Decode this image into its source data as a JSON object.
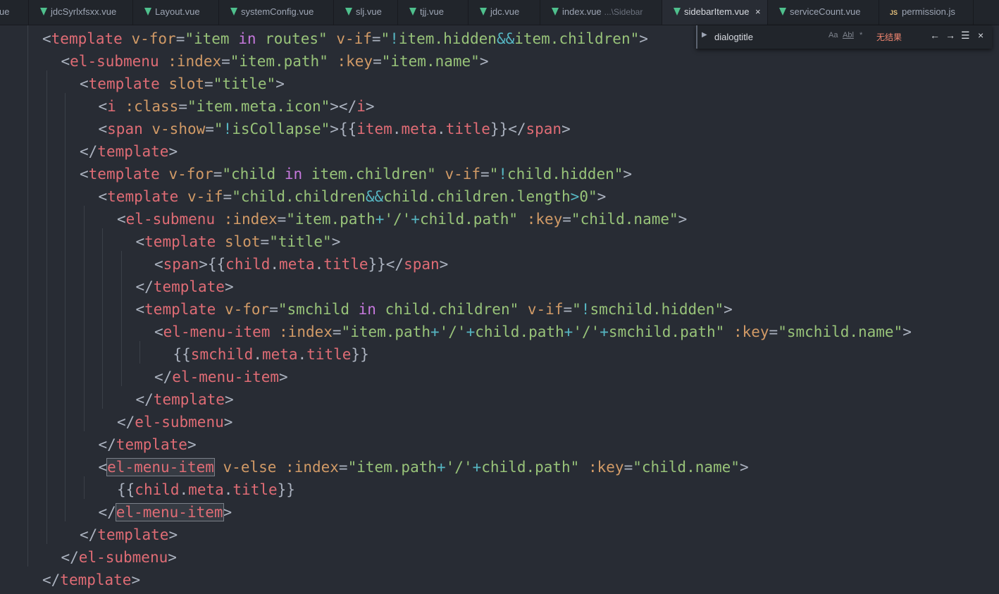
{
  "colors": {
    "editor_bg": "#282c34",
    "tag": "#e06c75",
    "attribute": "#d19a66",
    "string": "#98c379",
    "keyword": "#c678dd",
    "operator": "#56b6c2",
    "text": "#abb2bf",
    "vue_icon": "#4fc08d"
  },
  "tabs": [
    {
      "label": "ue",
      "icon": "",
      "hint": ""
    },
    {
      "label": "jdcSyrlxfsxx.vue",
      "icon": "vue-icon",
      "hint": ""
    },
    {
      "label": "Layout.vue",
      "icon": "vue-icon",
      "hint": ""
    },
    {
      "label": "systemConfig.vue",
      "icon": "vue-icon",
      "hint": ""
    },
    {
      "label": "slj.vue",
      "icon": "vue-icon",
      "hint": ""
    },
    {
      "label": "tjj.vue",
      "icon": "vue-icon",
      "hint": ""
    },
    {
      "label": "jdc.vue",
      "icon": "vue-icon",
      "hint": ""
    },
    {
      "label": "index.vue",
      "icon": "vue-icon",
      "hint": "...\\Sidebar"
    },
    {
      "label": "sidebarItem.vue",
      "icon": "vue-icon",
      "hint": ""
    },
    {
      "label": "serviceCount.vue",
      "icon": "vue-icon",
      "hint": ""
    },
    {
      "label": "permission.js",
      "icon": "js-icon",
      "hint": ""
    }
  ],
  "active_tab_close": "×",
  "js_icon_text": "JS",
  "find": {
    "value": "dialogtitle",
    "match_case": "Aa",
    "whole_word": "Abl",
    "regex": "*",
    "result": "无结果",
    "prev": "←",
    "next": "→",
    "in_selection": "☰",
    "close": "×"
  },
  "code_lines": [
    [
      [
        "t",
        "<"
      ],
      [
        "tag",
        "template"
      ],
      [
        "t",
        " "
      ],
      [
        "attr",
        "v-for"
      ],
      [
        "t",
        "="
      ],
      [
        "str",
        "\"item "
      ],
      [
        "kw",
        "in"
      ],
      [
        "str",
        " routes\""
      ],
      [
        "t",
        " "
      ],
      [
        "attr",
        "v-if"
      ],
      [
        "t",
        "="
      ],
      [
        "str",
        "\""
      ],
      [
        "op",
        "!"
      ],
      [
        "str",
        "item.hidden"
      ],
      [
        "op",
        "&&"
      ],
      [
        "str",
        "item.children\""
      ],
      [
        "t",
        ">"
      ]
    ],
    [
      [
        "t",
        "<"
      ],
      [
        "tag",
        "el-submenu"
      ],
      [
        "t",
        " "
      ],
      [
        "attr",
        ":index"
      ],
      [
        "t",
        "="
      ],
      [
        "str",
        "\"item.path\""
      ],
      [
        "t",
        " "
      ],
      [
        "attr",
        ":key"
      ],
      [
        "t",
        "="
      ],
      [
        "str",
        "\"item.name\""
      ],
      [
        "t",
        ">"
      ]
    ],
    [
      [
        "t",
        "<"
      ],
      [
        "tag",
        "template"
      ],
      [
        "t",
        " "
      ],
      [
        "attr",
        "slot"
      ],
      [
        "t",
        "="
      ],
      [
        "str",
        "\"title\""
      ],
      [
        "t",
        ">"
      ]
    ],
    [
      [
        "t",
        "<"
      ],
      [
        "tag",
        "i"
      ],
      [
        "t",
        " "
      ],
      [
        "attr",
        ":class"
      ],
      [
        "t",
        "="
      ],
      [
        "str",
        "\"item.meta.icon\""
      ],
      [
        "t",
        "></"
      ],
      [
        "tag",
        "i"
      ],
      [
        "t",
        ">"
      ]
    ],
    [
      [
        "t",
        "<"
      ],
      [
        "tag",
        "span"
      ],
      [
        "t",
        " "
      ],
      [
        "attr",
        "v-show"
      ],
      [
        "t",
        "="
      ],
      [
        "str",
        "\""
      ],
      [
        "op",
        "!"
      ],
      [
        "str",
        "isCollapse\""
      ],
      [
        "t",
        ">{{"
      ],
      [
        "tag",
        "item"
      ],
      [
        "t",
        "."
      ],
      [
        "tag",
        "meta"
      ],
      [
        "t",
        "."
      ],
      [
        "tag",
        "title"
      ],
      [
        "t",
        "}}</"
      ],
      [
        "tag",
        "span"
      ],
      [
        "t",
        ">"
      ]
    ],
    [
      [
        "t",
        "</"
      ],
      [
        "tag",
        "template"
      ],
      [
        "t",
        ">"
      ]
    ],
    [
      [
        "t",
        "<"
      ],
      [
        "tag",
        "template"
      ],
      [
        "t",
        " "
      ],
      [
        "attr",
        "v-for"
      ],
      [
        "t",
        "="
      ],
      [
        "str",
        "\"child "
      ],
      [
        "kw",
        "in"
      ],
      [
        "str",
        " item.children\""
      ],
      [
        "t",
        " "
      ],
      [
        "attr",
        "v-if"
      ],
      [
        "t",
        "="
      ],
      [
        "str",
        "\""
      ],
      [
        "op",
        "!"
      ],
      [
        "str",
        "child.hidden\""
      ],
      [
        "t",
        ">"
      ]
    ],
    [
      [
        "t",
        "<"
      ],
      [
        "tag",
        "template"
      ],
      [
        "t",
        " "
      ],
      [
        "attr",
        "v-if"
      ],
      [
        "t",
        "="
      ],
      [
        "str",
        "\"child.children"
      ],
      [
        "op",
        "&&"
      ],
      [
        "str",
        "child.children.length"
      ],
      [
        "op",
        ">"
      ],
      [
        "str",
        "0\""
      ],
      [
        "t",
        ">"
      ]
    ],
    [
      [
        "t",
        "<"
      ],
      [
        "tag",
        "el-submenu"
      ],
      [
        "t",
        " "
      ],
      [
        "attr",
        ":index"
      ],
      [
        "t",
        "="
      ],
      [
        "str",
        "\"item.path"
      ],
      [
        "op",
        "+"
      ],
      [
        "str",
        "'/'"
      ],
      [
        "op",
        "+"
      ],
      [
        "str",
        "child.path\""
      ],
      [
        "t",
        " "
      ],
      [
        "attr",
        ":key"
      ],
      [
        "t",
        "="
      ],
      [
        "str",
        "\"child.name\""
      ],
      [
        "t",
        ">"
      ]
    ],
    [
      [
        "t",
        "<"
      ],
      [
        "tag",
        "template"
      ],
      [
        "t",
        " "
      ],
      [
        "attr",
        "slot"
      ],
      [
        "t",
        "="
      ],
      [
        "str",
        "\"title\""
      ],
      [
        "t",
        ">"
      ]
    ],
    [
      [
        "t",
        "<"
      ],
      [
        "tag",
        "span"
      ],
      [
        "t",
        ">{{"
      ],
      [
        "tag",
        "child"
      ],
      [
        "t",
        "."
      ],
      [
        "tag",
        "meta"
      ],
      [
        "t",
        "."
      ],
      [
        "tag",
        "title"
      ],
      [
        "t",
        "}}</"
      ],
      [
        "tag",
        "span"
      ],
      [
        "t",
        ">"
      ]
    ],
    [
      [
        "t",
        "</"
      ],
      [
        "tag",
        "template"
      ],
      [
        "t",
        ">"
      ]
    ],
    [
      [
        "t",
        "<"
      ],
      [
        "tag",
        "template"
      ],
      [
        "t",
        " "
      ],
      [
        "attr",
        "v-for"
      ],
      [
        "t",
        "="
      ],
      [
        "str",
        "\"smchild "
      ],
      [
        "kw",
        "in"
      ],
      [
        "str",
        " child.children\""
      ],
      [
        "t",
        " "
      ],
      [
        "attr",
        "v-if"
      ],
      [
        "t",
        "="
      ],
      [
        "str",
        "\""
      ],
      [
        "op",
        "!"
      ],
      [
        "str",
        "smchild.hidden\""
      ],
      [
        "t",
        ">"
      ]
    ],
    [
      [
        "t",
        "<"
      ],
      [
        "tag",
        "el-menu-item"
      ],
      [
        "t",
        " "
      ],
      [
        "attr",
        ":index"
      ],
      [
        "t",
        "="
      ],
      [
        "str",
        "\"item.path"
      ],
      [
        "op",
        "+"
      ],
      [
        "str",
        "'/'"
      ],
      [
        "op",
        "+"
      ],
      [
        "str",
        "child.path"
      ],
      [
        "op",
        "+"
      ],
      [
        "str",
        "'/'"
      ],
      [
        "op",
        "+"
      ],
      [
        "str",
        "smchild.path\""
      ],
      [
        "t",
        " "
      ],
      [
        "attr",
        ":key"
      ],
      [
        "t",
        "="
      ],
      [
        "str",
        "\"smchild.name\""
      ],
      [
        "t",
        ">"
      ]
    ],
    [
      [
        "t",
        "{{"
      ],
      [
        "tag",
        "smchild"
      ],
      [
        "t",
        "."
      ],
      [
        "tag",
        "meta"
      ],
      [
        "t",
        "."
      ],
      [
        "tag",
        "title"
      ],
      [
        "t",
        "}}"
      ]
    ],
    [
      [
        "t",
        "</"
      ],
      [
        "tag",
        "el-menu-item"
      ],
      [
        "t",
        ">"
      ]
    ],
    [
      [
        "t",
        "</"
      ],
      [
        "tag",
        "template"
      ],
      [
        "t",
        ">"
      ]
    ],
    [
      [
        "t",
        "</"
      ],
      [
        "tag",
        "el-submenu"
      ],
      [
        "t",
        ">"
      ]
    ],
    [
      [
        "t",
        "</"
      ],
      [
        "tag",
        "template"
      ],
      [
        "t",
        ">"
      ]
    ],
    [
      [
        "t",
        "<"
      ],
      [
        "tag hl",
        "el-menu-item"
      ],
      [
        "t",
        " "
      ],
      [
        "attr",
        "v-else"
      ],
      [
        "t",
        " "
      ],
      [
        "attr",
        ":index"
      ],
      [
        "t",
        "="
      ],
      [
        "str",
        "\"item.path"
      ],
      [
        "op",
        "+"
      ],
      [
        "str",
        "'/'"
      ],
      [
        "op",
        "+"
      ],
      [
        "str",
        "child.path\""
      ],
      [
        "t",
        " "
      ],
      [
        "attr",
        ":key"
      ],
      [
        "t",
        "="
      ],
      [
        "str",
        "\"child.name\""
      ],
      [
        "t",
        ">"
      ]
    ],
    [
      [
        "t",
        "{{"
      ],
      [
        "tag",
        "child"
      ],
      [
        "t",
        "."
      ],
      [
        "tag",
        "meta"
      ],
      [
        "t",
        "."
      ],
      [
        "tag",
        "title"
      ],
      [
        "t",
        "}}"
      ]
    ],
    [
      [
        "t",
        "</"
      ],
      [
        "tag hl",
        "el-menu-item"
      ],
      [
        "t",
        ">"
      ]
    ],
    [
      [
        "t",
        "</"
      ],
      [
        "tag",
        "template"
      ],
      [
        "t",
        ">"
      ]
    ],
    [
      [
        "t",
        "</"
      ],
      [
        "tag",
        "el-submenu"
      ],
      [
        "t",
        ">"
      ]
    ],
    [
      [
        "t",
        "</"
      ],
      [
        "tag",
        "template"
      ],
      [
        "t",
        ">"
      ]
    ]
  ]
}
